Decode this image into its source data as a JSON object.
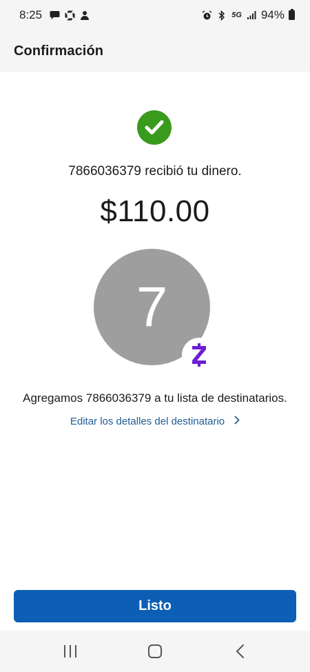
{
  "status_bar": {
    "time": "8:25",
    "network": "5G",
    "battery": "94%"
  },
  "header": {
    "title": "Confirmación"
  },
  "confirmation": {
    "message": "7866036379 recibió tu dinero.",
    "amount": "$110.00",
    "avatar_initial": "7",
    "added_text": "Agregamos 7866036379 a tu lista de destinatarios.",
    "edit_link": "Editar los detalles del destinatario"
  },
  "actions": {
    "done_label": "Listo"
  },
  "colors": {
    "success_green": "#3a9a1e",
    "primary_blue": "#0c5fb5",
    "link_blue": "#1f5b94",
    "avatar_gray": "#9e9e9e",
    "zelle_purple": "#6d1ed4"
  },
  "icons": {
    "status_left": [
      "chat-bubble-icon",
      "chase-icon",
      "app-icon"
    ],
    "status_right": [
      "alarm-icon",
      "bluetooth-icon",
      "5g-icon",
      "signal-icon",
      "battery-icon"
    ],
    "check": "check-icon",
    "badge": "zelle-icon",
    "chevron": "chevron-right-icon",
    "nav": [
      "recent-apps-icon",
      "home-icon",
      "back-icon"
    ]
  }
}
